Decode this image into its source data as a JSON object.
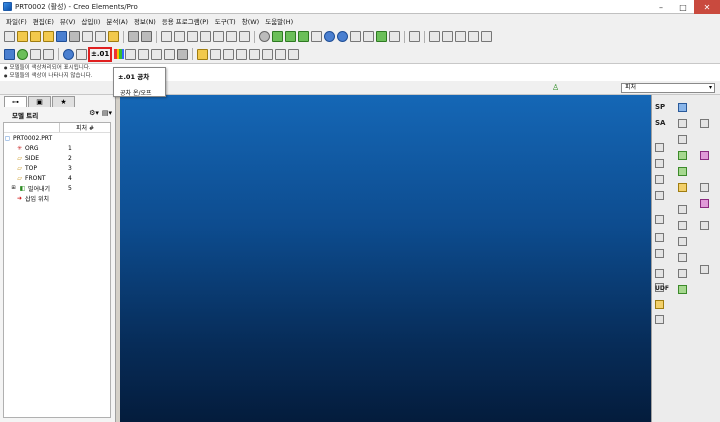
{
  "window": {
    "title": "PRT0002 (활성) - Creo Elements/Pro",
    "controls": {
      "minimize": "–",
      "maximize": "□",
      "close": "✕"
    }
  },
  "menu": [
    "파일(F)",
    "편집(E)",
    "뷰(V)",
    "삽입(I)",
    "분석(A)",
    "정보(N)",
    "응용 프로그램(P)",
    "도구(T)",
    "창(W)",
    "도움말(H)"
  ],
  "toolbar": {
    "tolerance_button_label": "±.01"
  },
  "messages": [
    "모델들이 색상처리되어 표시됩니다.",
    "모델들의 색상이 나타나지 않습니다."
  ],
  "tooltip": {
    "title": "±.01 공차",
    "subtitle": "공차 온/오프"
  },
  "filter": {
    "selected": "피처"
  },
  "model_tree": {
    "title": "모델 트리",
    "column_header": "피처 #",
    "root": "PRT0002.PRT",
    "items": [
      {
        "icon": "csys-icon",
        "label": "ORG",
        "num": "1"
      },
      {
        "icon": "datum-plane-icon",
        "label": "SIDE",
        "num": "2"
      },
      {
        "icon": "datum-plane-icon",
        "label": "TOP",
        "num": "3"
      },
      {
        "icon": "datum-plane-icon",
        "label": "FRONT",
        "num": "4"
      },
      {
        "icon": "extrude-icon",
        "label": "밀어내기",
        "num": "5"
      },
      {
        "icon": "insert-here-icon",
        "label": "삽입 위치",
        "num": ""
      }
    ]
  },
  "right_panel": {
    "sketch_label": "SP",
    "sa_label": "SA",
    "udf_label": "UDF"
  }
}
